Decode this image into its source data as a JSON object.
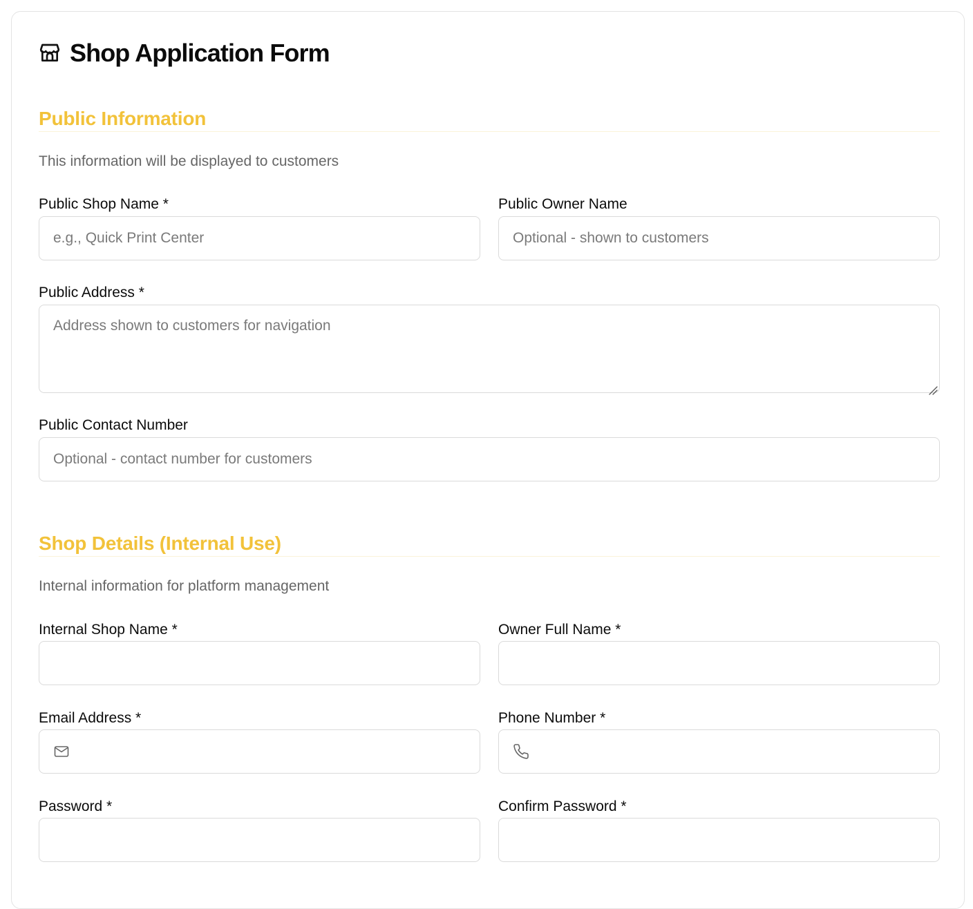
{
  "colors": {
    "accent": "#f2c23a",
    "border": "#dadada",
    "muted_text": "#666666"
  },
  "form": {
    "title": "Shop Application Form",
    "title_icon": "store-icon"
  },
  "public_section": {
    "title": "Public Information",
    "description": "This information will be displayed to customers",
    "fields": {
      "shop_name": {
        "label": "Public Shop Name *",
        "placeholder": "e.g., Quick Print Center",
        "value": ""
      },
      "owner_name": {
        "label": "Public Owner Name",
        "placeholder": "Optional - shown to customers",
        "value": ""
      },
      "address": {
        "label": "Public Address *",
        "placeholder": "Address shown to customers for navigation",
        "value": ""
      },
      "contact_number": {
        "label": "Public Contact Number",
        "placeholder": "Optional - contact number for customers",
        "value": ""
      }
    }
  },
  "internal_section": {
    "title": "Shop Details (Internal Use)",
    "description": "Internal information for platform management",
    "fields": {
      "shop_name": {
        "label": "Internal Shop Name *",
        "value": ""
      },
      "owner_full_name": {
        "label": "Owner Full Name *",
        "value": ""
      },
      "email": {
        "label": "Email Address *",
        "icon": "mail-icon",
        "value": ""
      },
      "phone": {
        "label": "Phone Number *",
        "icon": "phone-icon",
        "value": ""
      },
      "password": {
        "label": "Password *",
        "value": ""
      },
      "confirm_password": {
        "label": "Confirm Password *",
        "value": ""
      }
    }
  }
}
